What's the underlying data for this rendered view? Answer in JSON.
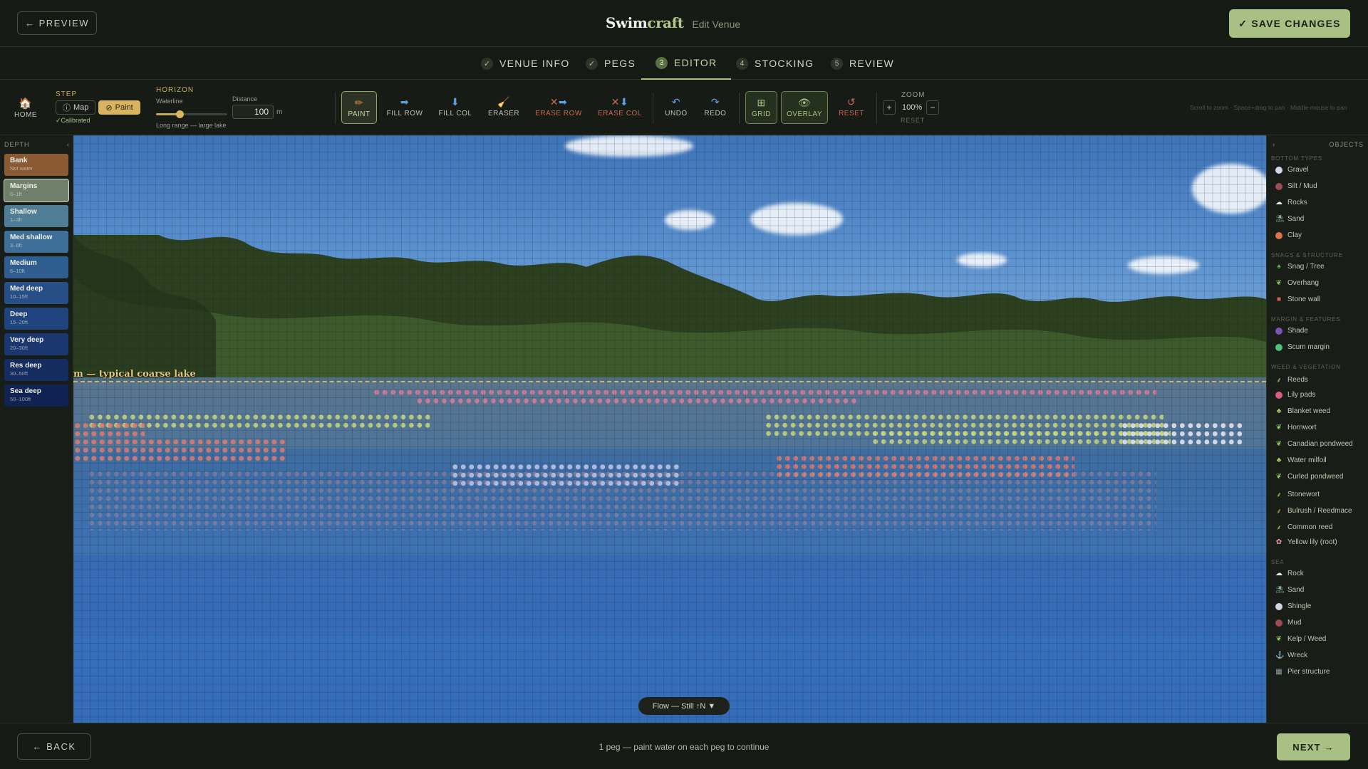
{
  "header": {
    "preview_label": "← PREVIEW",
    "brand_main": "Swim",
    "brand_accent": "craft",
    "brand_sub": "Edit Venue",
    "save_label": "✓ SAVE CHANGES"
  },
  "steps": [
    {
      "marker": "✓",
      "label": "VENUE INFO"
    },
    {
      "marker": "✓",
      "label": "PEGS"
    },
    {
      "marker": "3",
      "label": "EDITOR"
    },
    {
      "marker": "4",
      "label": "STOCKING"
    },
    {
      "marker": "5",
      "label": "REVIEW"
    }
  ],
  "toolbar": {
    "home_label": "HOME",
    "step_label": "STEP",
    "map_label": "Map",
    "paint_label": "Paint",
    "calibrated": "✓Calibrated",
    "horizon_label": "HORIZON",
    "waterline_label": "Waterline",
    "waterline_level": 0.33,
    "distance_label": "Distance",
    "distance_value": "100",
    "distance_unit": "m",
    "range_hint": "Long range — large lake",
    "tools": {
      "paint": "PAINT",
      "fill_row": "FILL ROW",
      "fill_col": "FILL COL",
      "eraser": "ERASER",
      "erase_row": "ERASE ROW",
      "erase_col": "ERASE COL",
      "undo": "UNDO",
      "redo": "REDO",
      "grid": "GRID",
      "overlay": "OVERLAY",
      "reset": "RESET"
    },
    "zoom_label": "ZOOM",
    "zoom_in": "+",
    "zoom_value": "100%",
    "zoom_out": "−",
    "zoom_reset": "RESET",
    "help_hint": "Scroll to zoom · Space+drag to pan · Middle-mouse to pan"
  },
  "depth": {
    "title": "DEPTH",
    "collapse": "‹",
    "items": [
      {
        "name": "Bank",
        "range": "Not water",
        "color": "#8a5a34"
      },
      {
        "name": "Margins",
        "range": "0–1ft",
        "color": "#6f7f6a"
      },
      {
        "name": "Shallow",
        "range": "1–3ft",
        "color": "#4f7d96"
      },
      {
        "name": "Med shallow",
        "range": "3–6ft",
        "color": "#3f6f99"
      },
      {
        "name": "Medium",
        "range": "6–10ft",
        "color": "#2f5d90"
      },
      {
        "name": "Med deep",
        "range": "10–15ft",
        "color": "#274f86"
      },
      {
        "name": "Deep",
        "range": "15–20ft",
        "color": "#1f437c"
      },
      {
        "name": "Very deep",
        "range": "20–30ft",
        "color": "#1a376f"
      },
      {
        "name": "Res deep",
        "range": "30–50ft",
        "color": "#152c61"
      },
      {
        "name": "Sea deep",
        "range": "50–100ft",
        "color": "#102252"
      }
    ]
  },
  "canvas": {
    "horizon_text": "m — typical coarse lake",
    "flow_label": "Flow — Still ↑N ▼"
  },
  "objects": {
    "title": "OBJECTS",
    "expand": "›",
    "categories": [
      {
        "label": "BOTTOM TYPES",
        "items": [
          {
            "name": "Gravel",
            "swatch": "#d9d3e6"
          },
          {
            "name": "Silt / Mud",
            "swatch": "#9b4b5a"
          },
          {
            "name": "Rocks",
            "glyph": "☁",
            "color": "#e8e8e8"
          },
          {
            "name": "Sand",
            "glyph": "⛱",
            "color": "#8ab0a8"
          },
          {
            "name": "Clay",
            "swatch": "#e0704a"
          }
        ]
      },
      {
        "label": "SNAGS & STRUCTURE",
        "items": [
          {
            "name": "Snag / Tree",
            "glyph": "♠",
            "color": "#6fae55"
          },
          {
            "name": "Overhang",
            "glyph": "❦",
            "color": "#8cc45a"
          },
          {
            "name": "Stone wall",
            "glyph": "■",
            "color": "#d7604a"
          }
        ]
      },
      {
        "label": "MARGIN & FEATURES",
        "items": [
          {
            "name": "Shade",
            "swatch": "#7a55b0"
          },
          {
            "name": "Scum margin",
            "swatch": "#4fbf7a"
          }
        ]
      },
      {
        "label": "WEED & VEGETATION",
        "items": [
          {
            "name": "Reeds",
            "glyph": "⸙",
            "color": "#9fcf6a"
          },
          {
            "name": "Lily pads",
            "swatch": "#d85a86"
          },
          {
            "name": "Blanket weed",
            "glyph": "♣",
            "color": "#a7c95a"
          },
          {
            "name": "Hornwort",
            "glyph": "❦",
            "color": "#8fcb5a"
          },
          {
            "name": "Canadian pondweed",
            "glyph": "❦",
            "color": "#8fcb5a"
          },
          {
            "name": "Water milfoil",
            "glyph": "♣",
            "color": "#a7c95a"
          },
          {
            "name": "Curled pondweed",
            "glyph": "❦",
            "color": "#8fcb5a"
          },
          {
            "name": "Stonewort",
            "glyph": "⸙",
            "color": "#9fcf6a"
          },
          {
            "name": "Bulrush / Reedmace",
            "glyph": "⸙",
            "color": "#c7a85a"
          },
          {
            "name": "Common reed",
            "glyph": "⸙",
            "color": "#9fcf6a"
          },
          {
            "name": "Yellow lily (root)",
            "glyph": "✿",
            "color": "#f0a0c0"
          }
        ]
      },
      {
        "label": "SEA",
        "items": [
          {
            "name": "Rock",
            "glyph": "☁",
            "color": "#e8e8e8"
          },
          {
            "name": "Sand",
            "glyph": "⛱",
            "color": "#8ab0a8"
          },
          {
            "name": "Shingle",
            "swatch": "#d9d3e6"
          },
          {
            "name": "Mud",
            "swatch": "#9b4b5a"
          },
          {
            "name": "Kelp / Weed",
            "glyph": "❦",
            "color": "#8fcb5a"
          },
          {
            "name": "Wreck",
            "glyph": "⚓",
            "color": "#6fa0d8"
          },
          {
            "name": "Pier structure",
            "glyph": "▦",
            "color": "#8aa0a8"
          }
        ]
      }
    ]
  },
  "footer": {
    "back_label": "← BACK",
    "message": "1 peg — paint water on each peg to continue",
    "next_label": "NEXT →"
  }
}
